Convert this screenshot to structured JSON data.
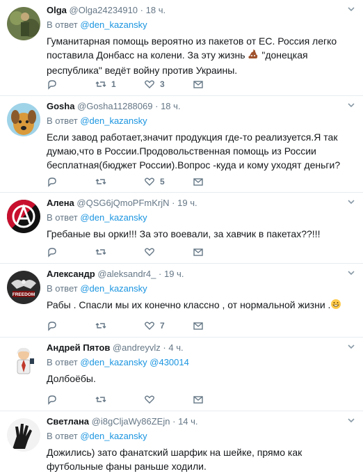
{
  "reply_prefix": "В ответ",
  "tweets": [
    {
      "name": "Olga",
      "handle": "@Olga24234910",
      "time": "18 ч.",
      "reply_to": [
        "@den_kazansky"
      ],
      "text_before_emoji": "Гуманитарная помощь вероятно из пакетов от ЕС. Россия легко поставила Донбасс на колени.  За эту жизнь ",
      "emoji": "pile-of-poo-emoji",
      "text_after_emoji": " \"донецкая республика\" ведёт войну против Украины.",
      "retweets": "1",
      "likes": "3"
    },
    {
      "name": "Gosha",
      "handle": "@Gosha11288069",
      "time": "18 ч.",
      "reply_to": [
        "@den_kazansky"
      ],
      "text": "Если завод работает,значит продукция где-то реализуется.Я так думаю,что в России.Продовольственная помощь из России бесплатная(бюджет России).Вопрос -куда  и кому уходят деньги?",
      "retweets": "",
      "likes": "5"
    },
    {
      "name": "Алена",
      "handle": "@QSG6jQmoPFmKrjN",
      "time": "19 ч.",
      "reply_to": [
        "@den_kazansky"
      ],
      "text": "Гребаные вы орки!!! За это воевали, за хавчик в пакетах??!!!",
      "retweets": "",
      "likes": ""
    },
    {
      "name": "Александр",
      "handle": "@aleksandr4_",
      "time": "19 ч.",
      "reply_to": [
        "@den_kazansky"
      ],
      "text_before_emoji": "Рабы . Спасли мы их конечно классно , от нормальной жизни .",
      "emoji": "grinning-face-emoji",
      "text_after_emoji": "",
      "avatar_text": "FREEDOM",
      "retweets": "",
      "likes": "7"
    },
    {
      "name": "Андрей Пятов",
      "handle": "@andreyvlz",
      "time": "4 ч.",
      "reply_to": [
        "@den_kazansky",
        "@430014"
      ],
      "text": "Долбоёбы.",
      "retweets": "",
      "likes": ""
    },
    {
      "name": "Светлана",
      "handle": "@i8gCljaWy86ZEjn",
      "time": "14 ч.",
      "reply_to": [
        "@den_kazansky"
      ],
      "text": "Дожились) зато фанатский шарфик на шейке, прямо как футбольные фаны раньше ходили.",
      "retweets": "",
      "likes": ""
    }
  ],
  "colors": {
    "link": "#1b95e0",
    "muted": "#657786",
    "text": "#14171a",
    "divider": "#e6ecf0"
  }
}
